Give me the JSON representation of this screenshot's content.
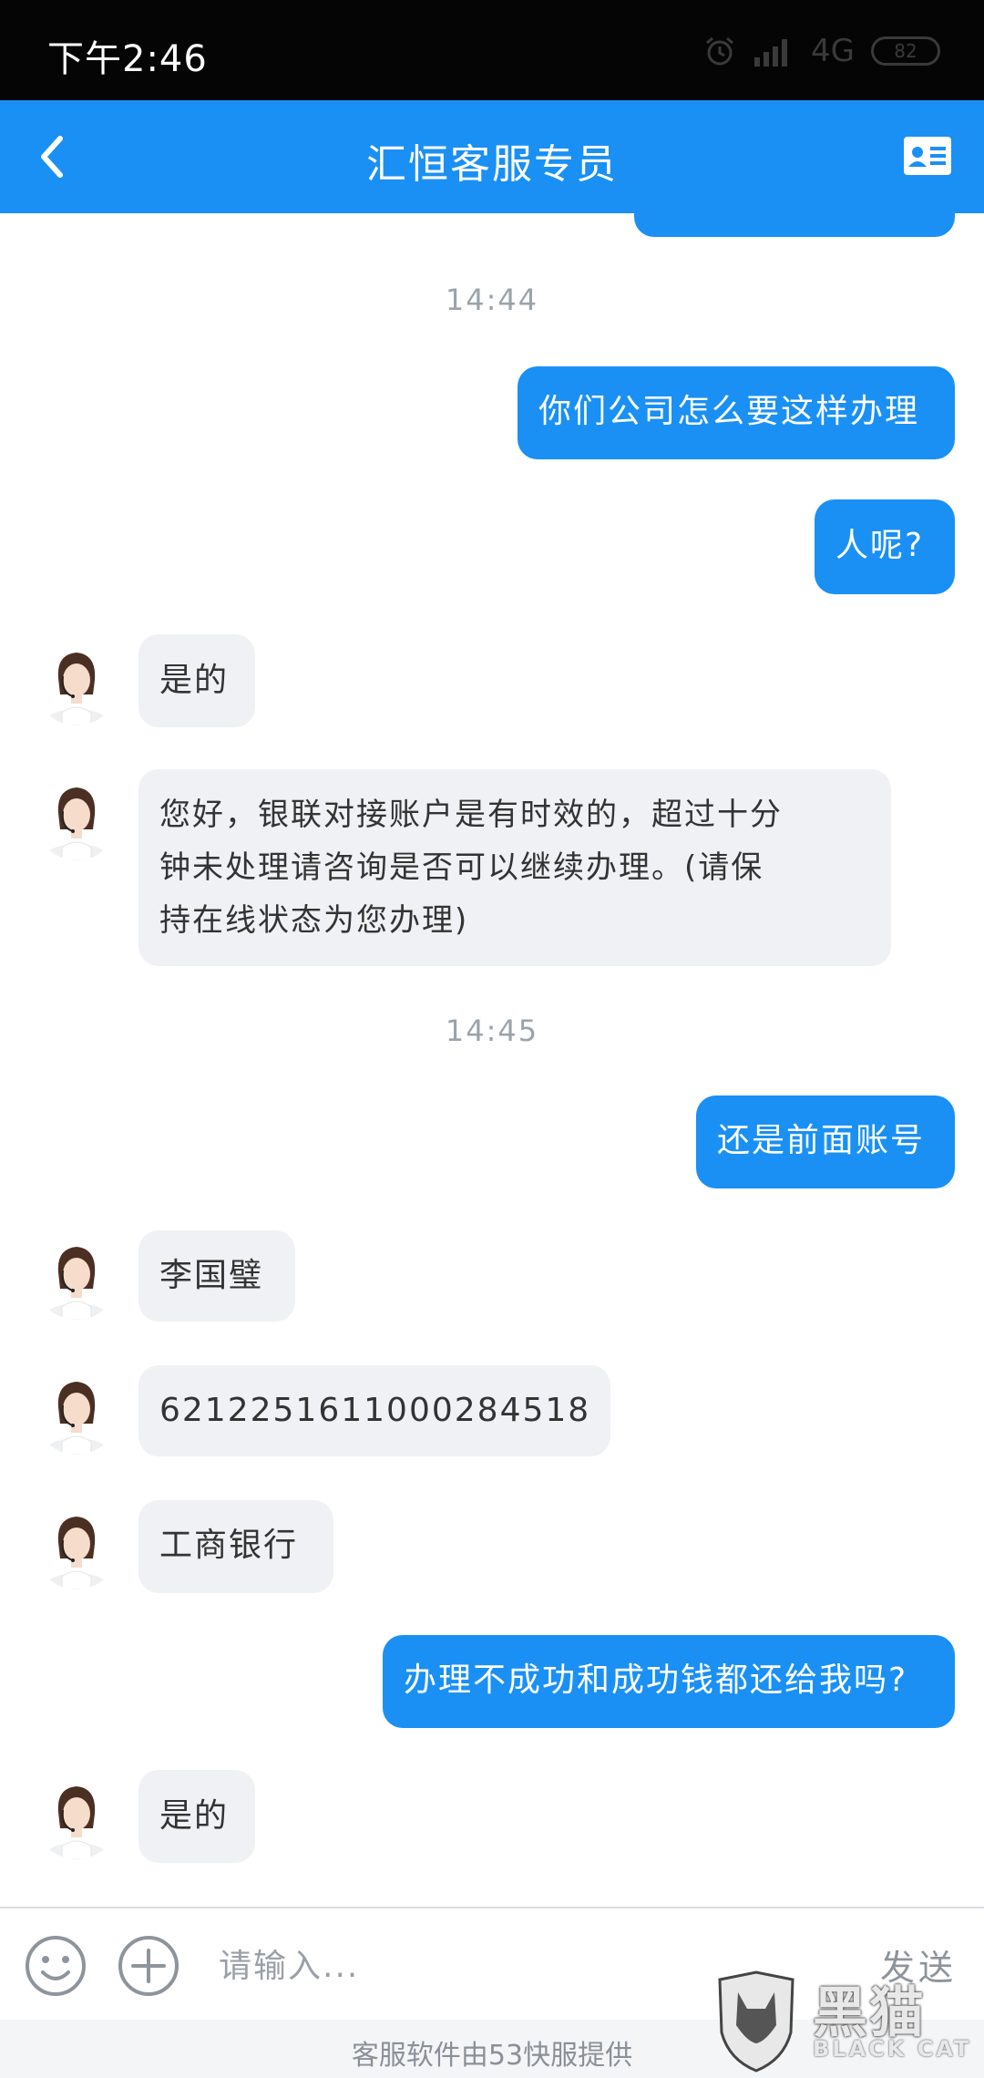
{
  "status_bar": {
    "time": "下午2:46",
    "network": "4G",
    "battery": "82"
  },
  "header": {
    "title": "汇恒客服专员"
  },
  "messages": {
    "ts1": "14:44",
    "m1": "你们公司怎么要这样办理",
    "m2": "人呢?",
    "m3": "是的",
    "m4_l1": "您好，银联对接账户是有时效的，超过十分",
    "m4_l2": "钟未处理请咨询是否可以继续办理。(请保",
    "m4_l3": "持在线状态为您办理)",
    "ts2": "14:45",
    "m5": "还是前面账号",
    "m6": "李国璧",
    "m7": "6212251611000284518",
    "m8": "工商银行",
    "m9": "办理不成功和成功钱都还给我吗?",
    "m10": "是的"
  },
  "input_bar": {
    "placeholder": "请输入...",
    "send_label": "发送"
  },
  "footer": {
    "text": "客服软件由53快服提供"
  },
  "watermark": {
    "title": "黑猫",
    "subtitle": "BLACK CAT"
  },
  "colors": {
    "accent": "#1a90f4",
    "incoming_bubble": "#eff1f4",
    "status_bar": "#050505"
  }
}
